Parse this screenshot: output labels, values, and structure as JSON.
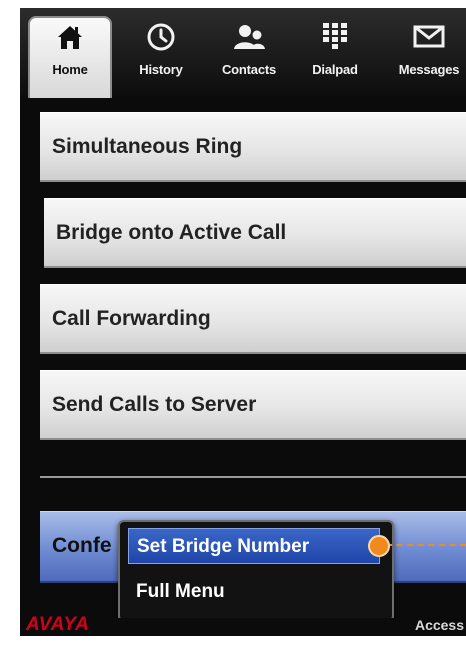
{
  "tabs": [
    {
      "label": "Home",
      "icon": "home-icon",
      "active": true
    },
    {
      "label": "History",
      "icon": "clock-icon",
      "active": false
    },
    {
      "label": "Contacts",
      "icon": "contacts-icon",
      "active": false
    },
    {
      "label": "Dialpad",
      "icon": "dialpad-icon",
      "active": false
    },
    {
      "label": "Messages",
      "icon": "envelope-icon",
      "active": false
    }
  ],
  "menu_rows": [
    {
      "label": "Simultaneous Ring"
    },
    {
      "label": "Bridge onto Active Call"
    },
    {
      "label": "Call Forwarding"
    },
    {
      "label": "Send Calls to Server"
    }
  ],
  "highlighted_row": {
    "label": "Confe"
  },
  "popup": {
    "items": [
      {
        "label": "Set Bridge Number",
        "selected": true
      },
      {
        "label": "Full Menu",
        "selected": false
      }
    ]
  },
  "footer": {
    "brand": "AVAYA",
    "right_text": "Access"
  },
  "colors": {
    "accent_blue": "#1f46a8",
    "callout_orange": "#f08a1c",
    "brand_red": "#d0021b"
  }
}
